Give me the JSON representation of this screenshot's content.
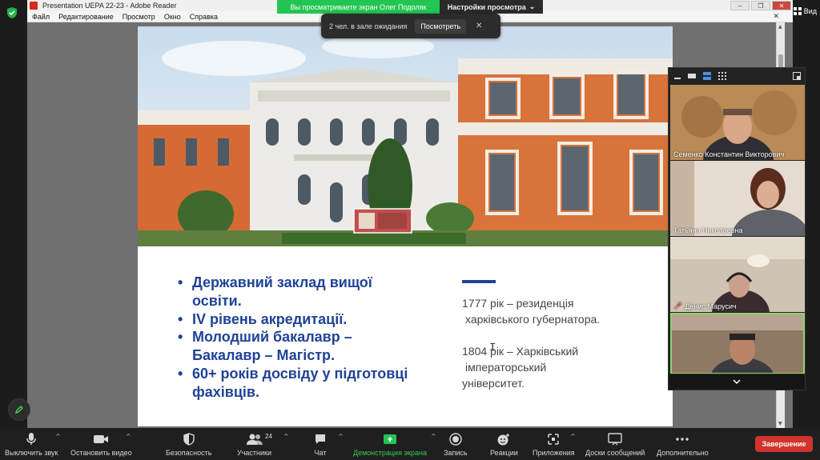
{
  "reader": {
    "title": "Presentation UEPA 22-23 - Adobe Reader",
    "menu": [
      "Файл",
      "Редактирование",
      "Просмотр",
      "Окно",
      "Справка"
    ]
  },
  "banner": {
    "sharing_text": "Вы просматриваете экран Олег Подоляк",
    "view_settings": "Настройки просмотра"
  },
  "waiting_room": {
    "text": "2 чел. в зале ожидания",
    "view_label": "Посмотреть"
  },
  "view_menu": {
    "label": "Вид"
  },
  "slide": {
    "bullets": [
      "Державний заклад вищої освіти.",
      "IV рівень акредитації.",
      "Молодший бакалавр – Бакалавр – Магістр.",
      "60+ років досвіду у підготовці фахівців."
    ],
    "history": [
      {
        "line1": "1777 рік – резиденція",
        "line2": "харківського губернатора."
      },
      {
        "line1": "1804 рік – Харківський",
        "line2": "імператорський",
        "line3": "університет."
      }
    ]
  },
  "participants": [
    {
      "name": "Семенко Константин Викторович",
      "muted": false
    },
    {
      "name": "Татьяна Николаевна",
      "muted": false
    },
    {
      "name": "Денис Марусич",
      "muted": true
    },
    {
      "name": "",
      "muted": false
    }
  ],
  "toolbar": {
    "mute": "Выключить звук",
    "video": "Остановить видео",
    "security": "Безопасность",
    "participants": "Участники",
    "participants_count": "24",
    "chat": "Чат",
    "share": "Демонстрация экрана",
    "record": "Запись",
    "reactions": "Реакции",
    "apps": "Приложения",
    "whiteboards": "Доски сообщений",
    "more": "Дополнительно",
    "end": "Завершение"
  },
  "colors": {
    "slide_blue": "#1f4396",
    "share_green": "#23c552",
    "end_red": "#d0342c",
    "active_speaker": "#8fd46a"
  }
}
